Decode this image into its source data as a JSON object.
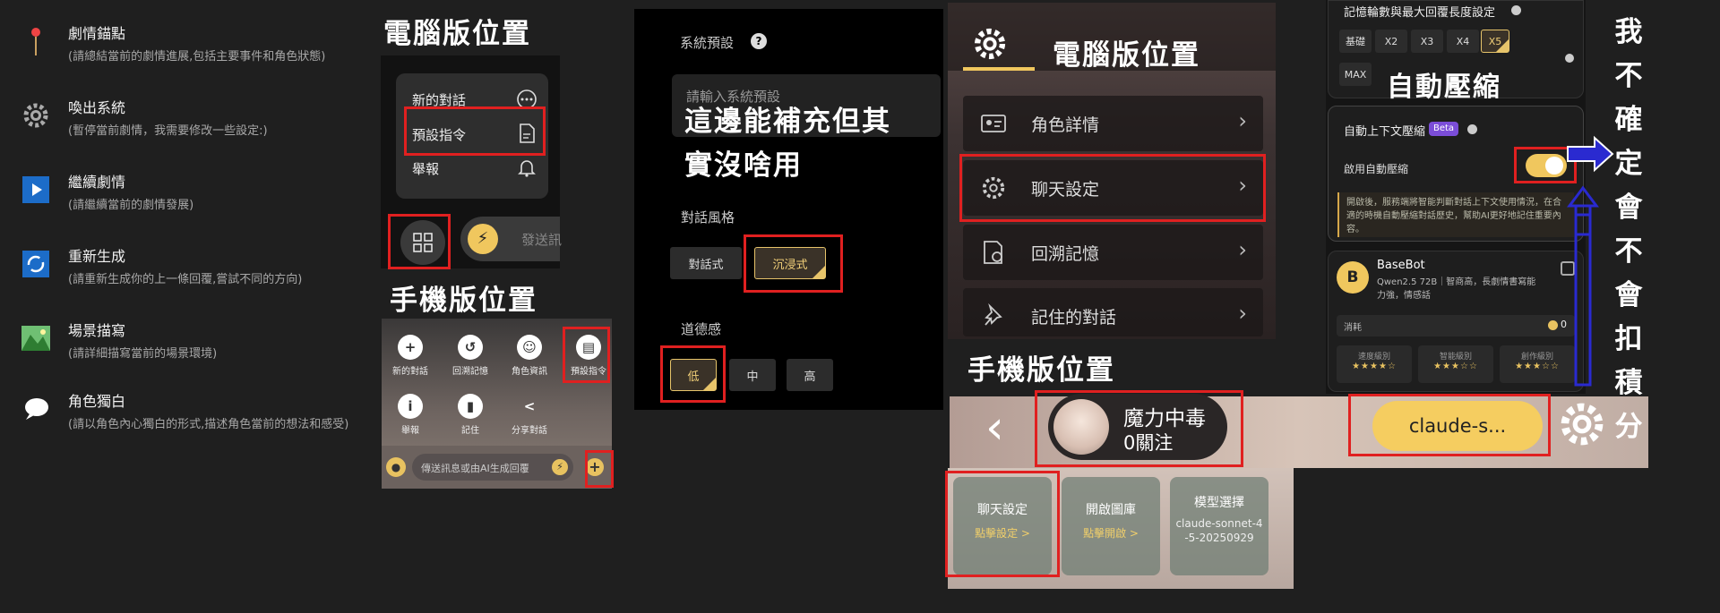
{
  "story_menu": {
    "items": [
      {
        "icon": "pin-icon",
        "title": "劇情錨點",
        "desc": "(請總結當前的劇情進展,包括主要事件和角色狀態)"
      },
      {
        "icon": "gear-icon",
        "title": "喚出系統",
        "desc": "(暫停當前劇情，我需要修改一些設定:)"
      },
      {
        "icon": "play-icon",
        "title": "繼續劇情",
        "desc": "(請繼續當前的劇情發展)"
      },
      {
        "icon": "refresh-icon",
        "title": "重新生成",
        "desc": "(請重新生成你的上一條回覆,嘗試不同的方向)"
      },
      {
        "icon": "landscape-icon",
        "title": "場景描寫",
        "desc": "(請詳細描寫當前的場景環境)"
      },
      {
        "icon": "speech-bubble-icon",
        "title": "角色獨白",
        "desc": "(請以角色內心獨白的形式,描述角色當前的想法和感受)"
      }
    ]
  },
  "captions": {
    "pc_location": "電腦版位置",
    "mobile_location": "手機版位置",
    "system_note": "這邊能補充但其實沒啥用",
    "auto_compress": "自動壓縮",
    "question": [
      "我",
      "不",
      "確",
      "定",
      "會",
      "不",
      "會",
      "扣",
      "積",
      "分"
    ]
  },
  "pc_popup": {
    "items": [
      "新的對話",
      "預設指令",
      "舉報"
    ],
    "send_placeholder": "發送訊"
  },
  "mobile_grid": {
    "items": [
      "新的對話",
      "回溯記憶",
      "角色資訊",
      "預設指令",
      "舉報",
      "記住",
      "分享對話"
    ],
    "input_placeholder": "傳送訊息或由AI生成回覆"
  },
  "system_settings": {
    "system_label": "系統預設",
    "help_glyph": "?",
    "system_placeholder": "請輸入系統預設",
    "style_label": "對話風格",
    "style_options": [
      "對話式",
      "沉浸式"
    ],
    "morality_label": "道德感",
    "morality_options": [
      "低",
      "中",
      "高"
    ]
  },
  "pc_settings": {
    "rows": [
      "角色詳情",
      "聊天設定",
      "回溯記憶",
      "記住的對話"
    ],
    "chevron": "›"
  },
  "mobile_bar": {
    "back": "‹",
    "character_name": "魔力中毒",
    "follow": "0關注",
    "model_button": "claude-s...",
    "cards": [
      {
        "title": "聊天設定",
        "sub": "點擊設定 >"
      },
      {
        "title": "開啟圖庫",
        "sub": "點擊開啟 >"
      },
      {
        "title": "模型選擇",
        "sub": "claude-sonnet-4-5-20250929"
      }
    ]
  },
  "compress_panel": {
    "memory_title": "記憶輪數與最大回覆長度設定",
    "memory_options": [
      "基礎",
      "X2",
      "X3",
      "X4",
      "X5",
      "MAX"
    ],
    "auto_title": "自動上下文壓縮",
    "beta": "Beta",
    "enable_label": "啟用自動壓縮",
    "enabled": true,
    "desc": "開啟後，服務端將智能判斷對話上下文使用情況，在合適的時機自動壓縮對話歷史，幫助AI更好地記住重要內容。",
    "bot_name": "BaseBot",
    "bot_avatar": "B",
    "bot_desc": "Qwen2.5 72B｜智商高，長劇情書寫能力強，情感話",
    "cost_label": "消耗",
    "cost_value": "0",
    "ratings": [
      {
        "label": "速度級別",
        "stars": "★★★★☆"
      },
      {
        "label": "智能級別",
        "stars": "★★★☆☆"
      },
      {
        "label": "創作級別",
        "stars": "★★★☆☆"
      }
    ]
  },
  "colors": {
    "highlight": "#e02020",
    "accent": "#f0c75e",
    "arrow": "#2a2ad0"
  }
}
